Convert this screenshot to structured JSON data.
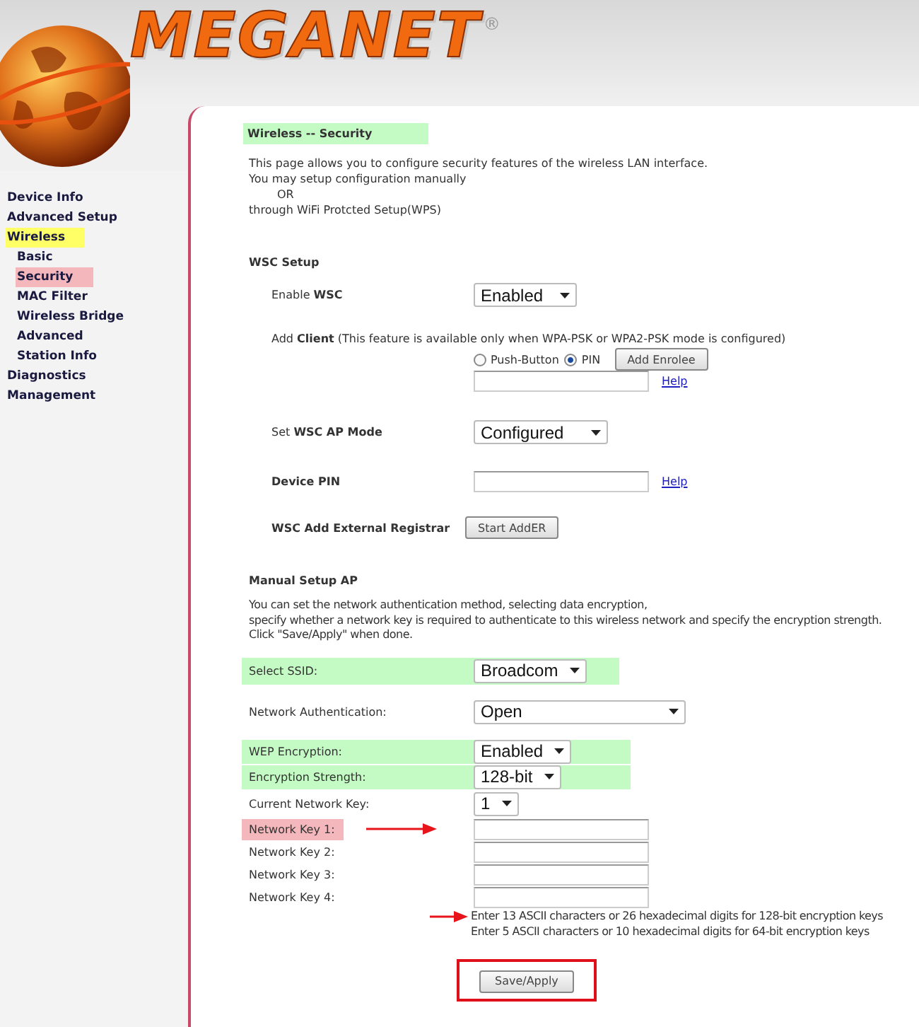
{
  "logo": {
    "text": "MEGANET",
    "mark": "®"
  },
  "nav": [
    {
      "label": "Device Info"
    },
    {
      "label": "Advanced Setup"
    },
    {
      "label": "Wireless",
      "color": "#ffff66",
      "children": [
        {
          "label": "Basic"
        },
        {
          "label": "Security",
          "color": "#f4b8bc"
        },
        {
          "label": "MAC Filter"
        },
        {
          "label": "Wireless Bridge"
        },
        {
          "label": "Advanced"
        },
        {
          "label": "Station Info"
        }
      ]
    },
    {
      "label": "Diagnostics"
    },
    {
      "label": "Management"
    }
  ],
  "title": {
    "text": "Wireless -- Security",
    "color": "#c4fbc4"
  },
  "intro": [
    "This page allows you to configure security features of the wireless LAN interface.",
    "You may setup configuration manually",
    "OR",
    "through WiFi Protcted Setup(WPS)"
  ],
  "wsc": {
    "heading": "WSC Setup",
    "rows": [
      {
        "kind": "select",
        "label": "Enable **WSC**",
        "value": "Enabled"
      },
      {
        "kind": "client",
        "label": "Add **Client** (This feature is available only when WPA-PSK or WPA2-PSK mode is configured)",
        "options": [
          {
            "label": "Push-Button",
            "selected": false
          },
          {
            "label": "PIN",
            "selected": true
          }
        ],
        "button": "Add Enrolee",
        "help": "Help"
      },
      {
        "kind": "select",
        "label": "Set **WSC AP Mode**",
        "value": "Configured"
      },
      {
        "kind": "field",
        "label": "Device PIN",
        "bold": true,
        "help": "Help"
      },
      {
        "kind": "button",
        "label": "WSC Add External Registrar",
        "bold": true,
        "button": "Start AddER"
      }
    ]
  },
  "manual": {
    "heading": "Manual Setup AP",
    "intro": [
      "You can set the network authentication method, selecting data encryption,",
      "specify whether a network key is required to authenticate to this wireless network and specify the encryption strength.",
      "Click \"Save/Apply\" when done."
    ],
    "rows": [
      {
        "kind": "select",
        "label": "Select SSID:",
        "value": "Broadcom",
        "color": "#c4fbc4"
      },
      {
        "kind": "select",
        "label": "Network Authentication:",
        "value": "Open",
        "wide": true
      },
      {
        "kind": "select",
        "label": "WEP Encryption:",
        "value": "Enabled",
        "color": "#c4fbc4"
      },
      {
        "kind": "select",
        "label": "Encryption Strength:",
        "value": "128-bit",
        "color": "#c4fbc4"
      },
      {
        "kind": "select",
        "label": "Current Network Key:",
        "value": "1"
      },
      {
        "kind": "field",
        "label": "Network Key 1:",
        "label_highlight": {
          "color": "#f4b8bc"
        },
        "arrow": true
      },
      {
        "kind": "field",
        "label": "Network Key 2:"
      },
      {
        "kind": "field",
        "label": "Network Key 3:"
      },
      {
        "kind": "field",
        "label": "Network Key 4:"
      }
    ],
    "notes": [
      "Enter 13 ASCII characters or 26 hexadecimal digits for 128-bit encryption keys",
      "Enter 5 ASCII characters or 10 hexadecimal digits for 64-bit encryption keys"
    ],
    "notes_arrow": true,
    "save": {
      "label": "Save/Apply",
      "framed": true
    }
  }
}
